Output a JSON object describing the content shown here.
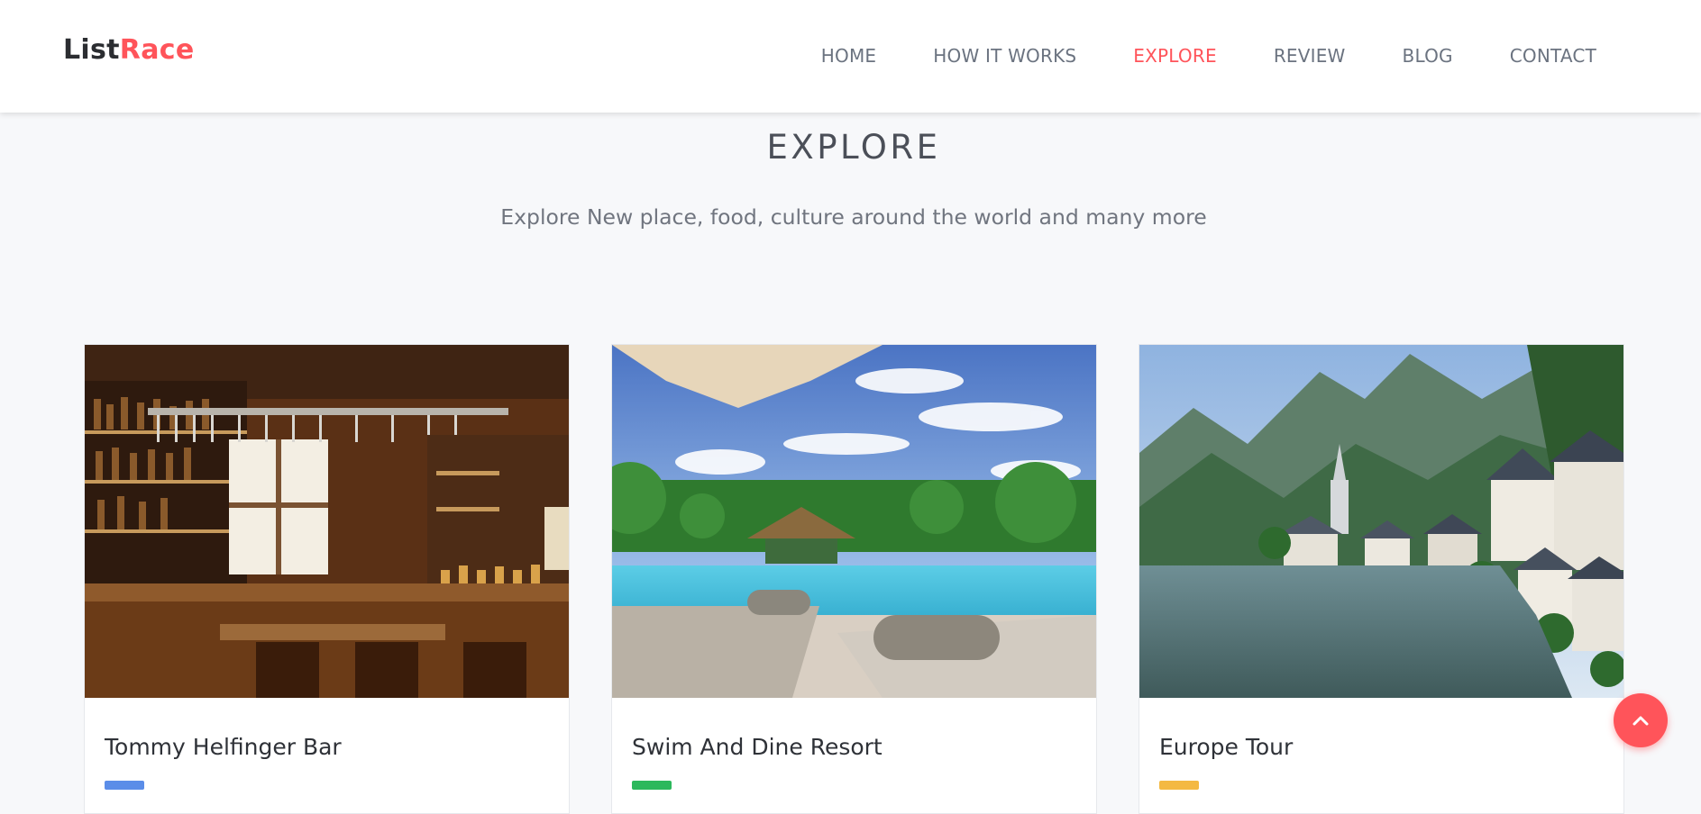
{
  "brand": {
    "part1": "List",
    "part2": "Race"
  },
  "nav": {
    "items": [
      {
        "label": "HOME"
      },
      {
        "label": "HOW IT WORKS"
      },
      {
        "label": "EXPLORE",
        "active": true
      },
      {
        "label": "REVIEW"
      },
      {
        "label": "BLOG"
      },
      {
        "label": "CONTACT"
      }
    ]
  },
  "section": {
    "title": "EXPLORE",
    "subtitle": "Explore New place, food, culture around the world and many more"
  },
  "cards": [
    {
      "title": "Tommy Helfinger Bar",
      "tag_color": "#5b8de8"
    },
    {
      "title": "Swim And Dine Resort",
      "tag_color": "#2cb85c"
    },
    {
      "title": "Europe Tour",
      "tag_color": "#f4b942"
    }
  ],
  "colors": {
    "accent": "#ff545a"
  },
  "icons": {
    "scroll_top": "chevron-up-icon"
  }
}
